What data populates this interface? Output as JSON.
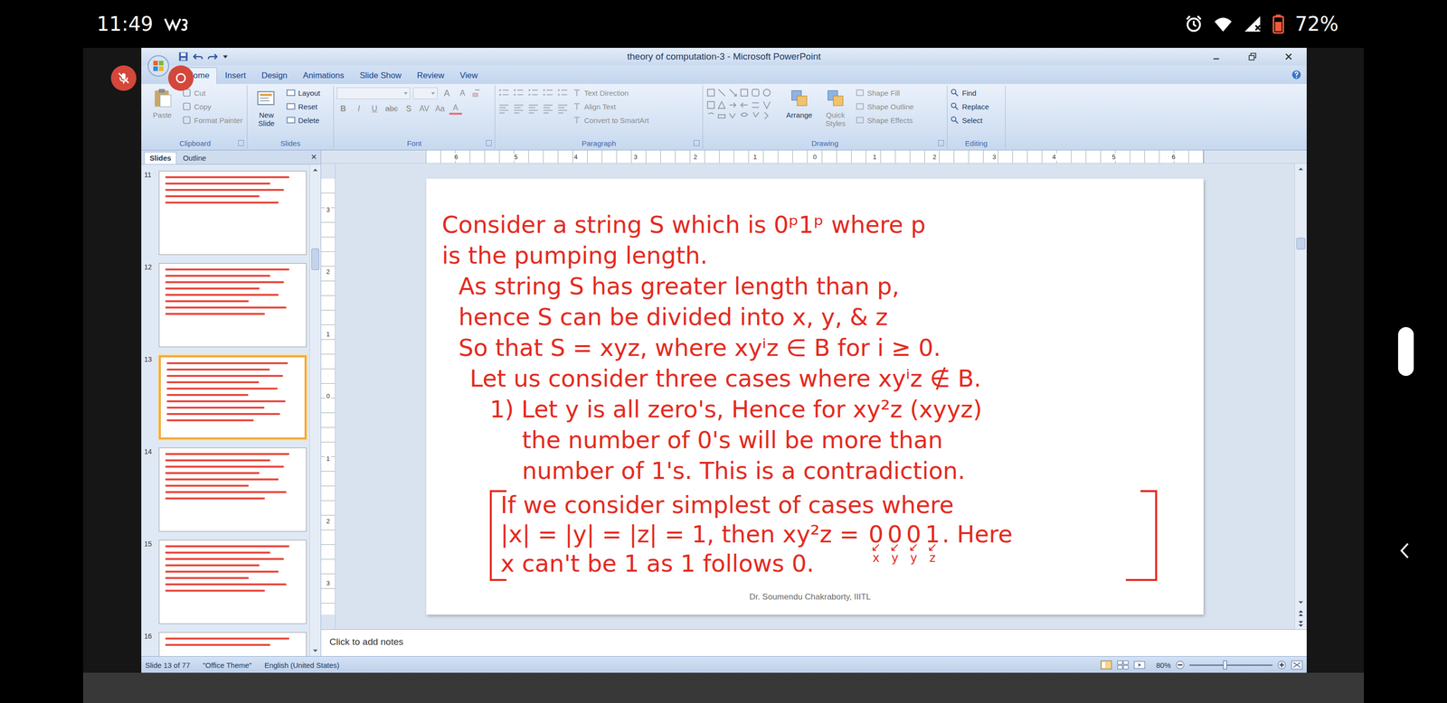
{
  "phone_status": {
    "time": "11:49",
    "battery": "72%",
    "battery_level": 0.72
  },
  "window": {
    "title": "theory of computation-3 - Microsoft PowerPoint"
  },
  "tabs": [
    {
      "label": "Home",
      "selected": true
    },
    {
      "label": "Insert",
      "selected": false
    },
    {
      "label": "Design",
      "selected": false
    },
    {
      "label": "Animations",
      "selected": false
    },
    {
      "label": "Slide Show",
      "selected": false
    },
    {
      "label": "Review",
      "selected": false
    },
    {
      "label": "View",
      "selected": false
    }
  ],
  "ribbon": {
    "clipboard": {
      "label": "Clipboard",
      "large": {
        "label": "Paste",
        "disabled": true
      },
      "items": [
        {
          "label": "Cut",
          "disabled": true
        },
        {
          "label": "Copy",
          "disabled": true
        },
        {
          "label": "Format Painter",
          "disabled": true
        }
      ]
    },
    "slides": {
      "label": "Slides",
      "large": {
        "label": "New Slide",
        "disabled": false
      },
      "items": [
        {
          "label": "Layout",
          "disabled": false
        },
        {
          "label": "Reset",
          "disabled": false
        },
        {
          "label": "Delete",
          "disabled": false
        }
      ]
    },
    "font": {
      "label": "Font",
      "disabled": true,
      "tools_top": [
        "A",
        "A"
      ],
      "tools_bottom": [
        "B",
        "I",
        "U",
        "abc",
        "S",
        "AV",
        "Aa",
        "A"
      ]
    },
    "paragraph": {
      "label": "Paragraph",
      "items": [
        {
          "label": "Text Direction",
          "disabled": true
        },
        {
          "label": "Align Text",
          "disabled": true
        },
        {
          "label": "Convert to SmartArt",
          "disabled": true
        }
      ]
    },
    "drawing": {
      "label": "Drawing",
      "large": [
        {
          "label": "Arrange",
          "disabled": false
        },
        {
          "label": "Quick Styles",
          "disabled": true
        }
      ],
      "items": [
        {
          "label": "Shape Fill",
          "disabled": true
        },
        {
          "label": "Shape Outline",
          "disabled": true
        },
        {
          "label": "Shape Effects",
          "disabled": true
        }
      ]
    },
    "editing": {
      "label": "Editing",
      "items": [
        {
          "label": "Find",
          "disabled": false
        },
        {
          "label": "Replace",
          "disabled": false
        },
        {
          "label": "Select",
          "disabled": false
        }
      ]
    }
  },
  "panel": {
    "tabs": [
      {
        "label": "Slides",
        "selected": true
      },
      {
        "label": "Outline",
        "selected": false
      }
    ],
    "close": "×",
    "thumbnails": [
      {
        "number": "11",
        "selected": false,
        "lines": 5
      },
      {
        "number": "12",
        "selected": false,
        "lines": 8
      },
      {
        "number": "13",
        "selected": true,
        "lines": 10
      },
      {
        "number": "14",
        "selected": false,
        "lines": 8
      },
      {
        "number": "15",
        "selected": false,
        "lines": 8
      },
      {
        "number": "16",
        "selected": false,
        "lines": 2
      }
    ]
  },
  "ruler_h": [
    "6",
    "5",
    "4",
    "3",
    "2",
    "1",
    "0",
    "1",
    "2",
    "3",
    "4",
    "5",
    "6"
  ],
  "ruler_v": [
    "3",
    "2",
    "1",
    "0",
    "1",
    "2",
    "3"
  ],
  "slide": {
    "lines": [
      {
        "text": "Consider a string S which is 0ᵖ1ᵖ where p",
        "kind": "lead"
      },
      {
        "text": "is the pumping length.",
        "kind": "lead"
      },
      {
        "text": "As string S has greater length than p,",
        "kind": "body"
      },
      {
        "text": "hence S can be divided into x, y, & z",
        "kind": "body"
      },
      {
        "text": "So that S = xyz, where xyⁱz ∈ B for i ≥ 0.",
        "kind": "body"
      },
      {
        "text": "Let us consider three cases where xyⁱz ∉ B.",
        "kind": "case"
      },
      {
        "text": "1) Let y is all zero's, Hence for xy²z (xyyz)",
        "kind": "item"
      },
      {
        "text": "the number of 0's will be more than",
        "kind": "cont"
      },
      {
        "text": "number of 1's. This is a contradiction.",
        "kind": "cont"
      }
    ],
    "box": {
      "arrow": "↙",
      "lines": [
        {
          "text": "If we consider simplest of cases where"
        },
        {
          "before": "|x| = |y| = |z| = 1, then xy²z = ",
          "digits": [
            {
              "digit": "0",
              "label": "x"
            },
            {
              "digit": "0",
              "label": "y"
            },
            {
              "digit": "0",
              "label": "y"
            },
            {
              "digit": "1",
              "label": "z"
            }
          ],
          "after": ". Here"
        },
        {
          "text": "x can't be 1 as 1 follows 0."
        }
      ]
    },
    "footer": "Dr. Soumendu Chakraborty, IIITL"
  },
  "notes": {
    "placeholder": "Click to add notes"
  },
  "status_bar": {
    "slide": "Slide 13 of 77",
    "theme": "\"Office Theme\"",
    "language": "English (United States)",
    "zoom": "80%",
    "zoom_level": 0.43
  }
}
